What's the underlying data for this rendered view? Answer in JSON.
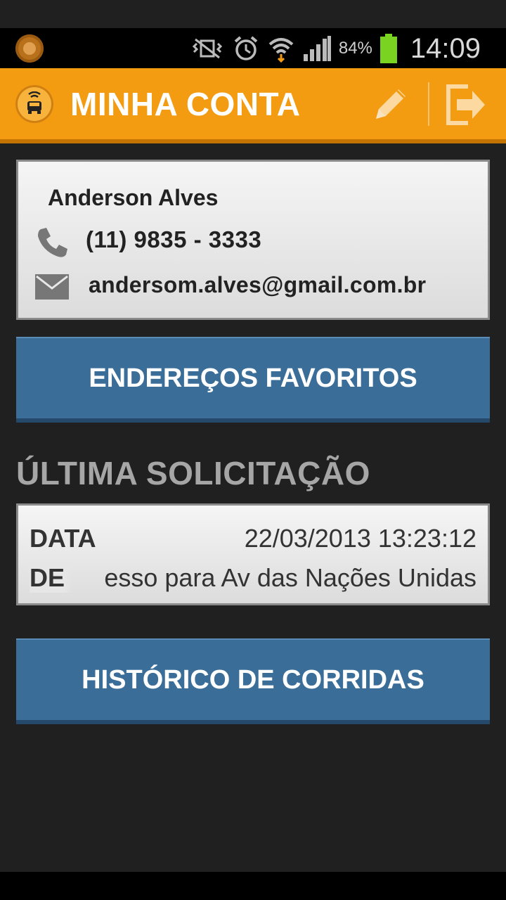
{
  "status_bar": {
    "battery": "84%",
    "time": "14:09",
    "colors": {
      "battery_fill": "#7bd321"
    }
  },
  "action_bar": {
    "title": "MINHA CONTA",
    "background": "#f39c12"
  },
  "profile": {
    "name": "Anderson Alves",
    "phone": "(11) 9835 - 3333",
    "email": "andersom.alves@gmail.com.br"
  },
  "buttons": {
    "favorite_addresses": "ENDEREÇOS FAVORITOS",
    "ride_history": "HISTÓRICO DE CORRIDAS",
    "color": "#3a6e99"
  },
  "last_request": {
    "section_title": "ÚLTIMA SOLICITAÇÃO",
    "date_label": "DATA",
    "date_value": "22/03/2013 13:23:12",
    "from_label": "DE",
    "from_value": "esso para Av das Nações Unidas"
  }
}
